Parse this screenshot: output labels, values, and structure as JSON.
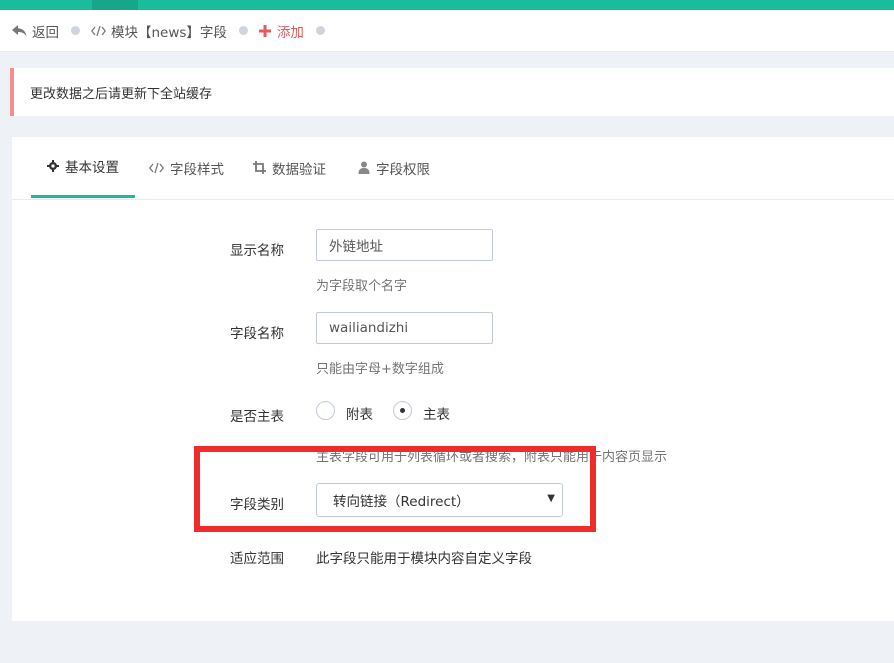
{
  "breadcrumb": {
    "back_label": "返回",
    "module_label": "模块【news】字段",
    "add_label": "添加"
  },
  "alert": {
    "message": "更改数据之后请更新下全站缓存"
  },
  "tabs": [
    {
      "label": "基本设置",
      "icon": "gear-icon"
    },
    {
      "label": "字段样式",
      "icon": "code-icon"
    },
    {
      "label": "数据验证",
      "icon": "crop-icon"
    },
    {
      "label": "字段权限",
      "icon": "user-icon"
    }
  ],
  "form": {
    "display_name": {
      "label": "显示名称",
      "value": "外链地址",
      "help": "为字段取个名字"
    },
    "field_name": {
      "label": "字段名称",
      "value": "wailiandizhi",
      "help": "只能由字母+数字组成"
    },
    "main_table": {
      "label": "是否主表",
      "options": [
        "附表",
        "主表"
      ],
      "selected": "主表",
      "help": "主表字段可用于列表循环或者搜索，附表只能用于内容页显示"
    },
    "field_type": {
      "label": "字段类别",
      "value": "转向链接（Redirect）"
    },
    "scope": {
      "label": "适应范围",
      "value": "此字段只能用于模块内容自定义字段"
    }
  },
  "colors": {
    "accent": "#1bbc9b",
    "add": "#e35b5a",
    "highlight": "#ef2b2b"
  }
}
